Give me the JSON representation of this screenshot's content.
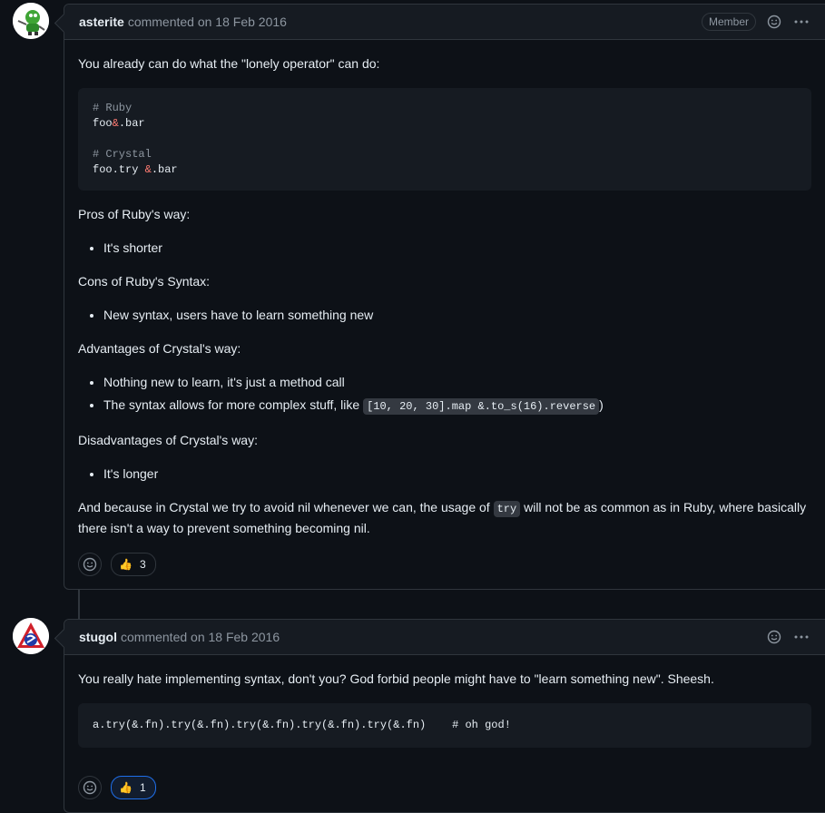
{
  "comments": [
    {
      "author": "asterite",
      "meta": "commented on 18 Feb 2016",
      "role_badge": "Member",
      "avatar_icon": "green-robot-avatar",
      "paragraph_1": "You already can do what the \"lonely operator\" can do:",
      "code_block": {
        "line_1_comment": "# Ruby",
        "line_2_a": "foo",
        "line_2_amp": "&",
        "line_2_b": ".bar",
        "line_4_comment": "# Crystal",
        "line_5_a": "foo.try ",
        "line_5_amp": "&",
        "line_5_b": ".bar"
      },
      "pros_heading": "Pros of Ruby's way:",
      "pros_items": [
        "It's shorter"
      ],
      "cons_heading": "Cons of Ruby's Syntax:",
      "cons_items": [
        "New syntax, users have to learn something new"
      ],
      "adv_heading": "Advantages of Crystal's way:",
      "adv_item_1": "Nothing new to learn, it's just a method call",
      "adv_item_2_prefix": "The syntax allows for more complex stuff, like ",
      "adv_item_2_code": "[10, 20, 30].map &.to_s(16).reverse",
      "adv_item_2_suffix": ")",
      "dis_heading": "Disadvantages of Crystal's way:",
      "dis_items": [
        "It's longer"
      ],
      "final_prefix": "And because in Crystal we try to avoid nil whenever we can, the usage of ",
      "final_code": "try",
      "final_suffix": " will not be as common as in Ruby, where basically there isn't a way to prevent something becoming nil.",
      "reaction": {
        "emoji": "👍",
        "count": "3"
      }
    },
    {
      "author": "stugol",
      "meta": "commented on 18 Feb 2016",
      "avatar_icon": "red-triangle-avatar",
      "paragraph_1": "You really hate implementing syntax, don't you? God forbid people might have to \"learn something new\". Sheesh.",
      "code_main": "a.try(&.fn).try(&.fn).try(&.fn).try(&.fn).try(&.fn)    ",
      "code_comment": "# oh god!",
      "reaction": {
        "emoji": "👍",
        "count": "1"
      }
    }
  ],
  "colors": {
    "background": "#0d1117",
    "header": "#161b22",
    "border": "#30363d",
    "muted_text": "#8d96a0",
    "active_reaction": "#1f6feb"
  }
}
